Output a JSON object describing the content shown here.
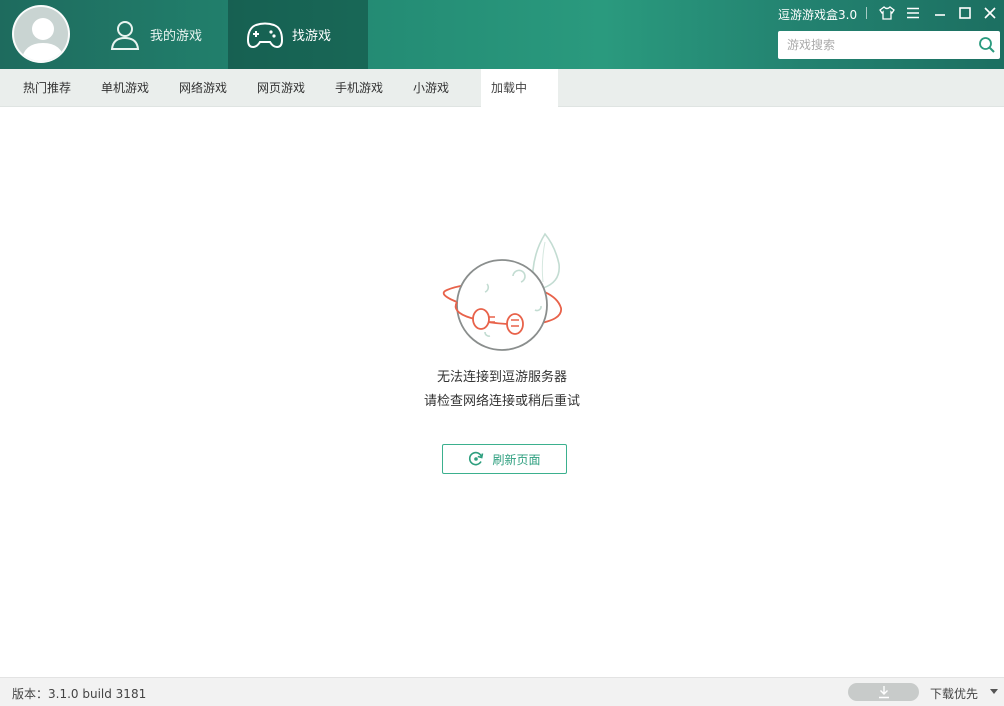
{
  "header": {
    "nav": [
      {
        "label": "我的游戏",
        "icon": "user-icon"
      },
      {
        "label": "找游戏",
        "icon": "gamepad-icon"
      }
    ],
    "app_title": "逗游游戏盒3.0",
    "controls": [
      "skin-icon",
      "menu-icon",
      "minimize-icon",
      "maximize-icon",
      "close-icon"
    ],
    "search": {
      "placeholder": "游戏搜索",
      "value": "",
      "icon": "search-icon"
    }
  },
  "subnav": {
    "tabs": [
      {
        "label": "热门推荐"
      },
      {
        "label": "单机游戏"
      },
      {
        "label": "网络游戏"
      },
      {
        "label": "网页游戏"
      },
      {
        "label": "手机游戏"
      },
      {
        "label": "小游戏"
      },
      {
        "label": "加载中",
        "active": true
      }
    ]
  },
  "content": {
    "illustration": "disconnected-planet-icon",
    "message_line1": "无法连接到逗游服务器",
    "message_line2": "请检查网络连接或稍后重试",
    "refresh_label": "刷新页面",
    "refresh_icon": "refresh-icon"
  },
  "footer": {
    "version": "版本：3.1.0 build 3181",
    "download_priority": "下载优先"
  },
  "colors": {
    "header_green": "#238a73",
    "accent_green": "#2e9f7f",
    "illustration_red": "#e8624a"
  }
}
